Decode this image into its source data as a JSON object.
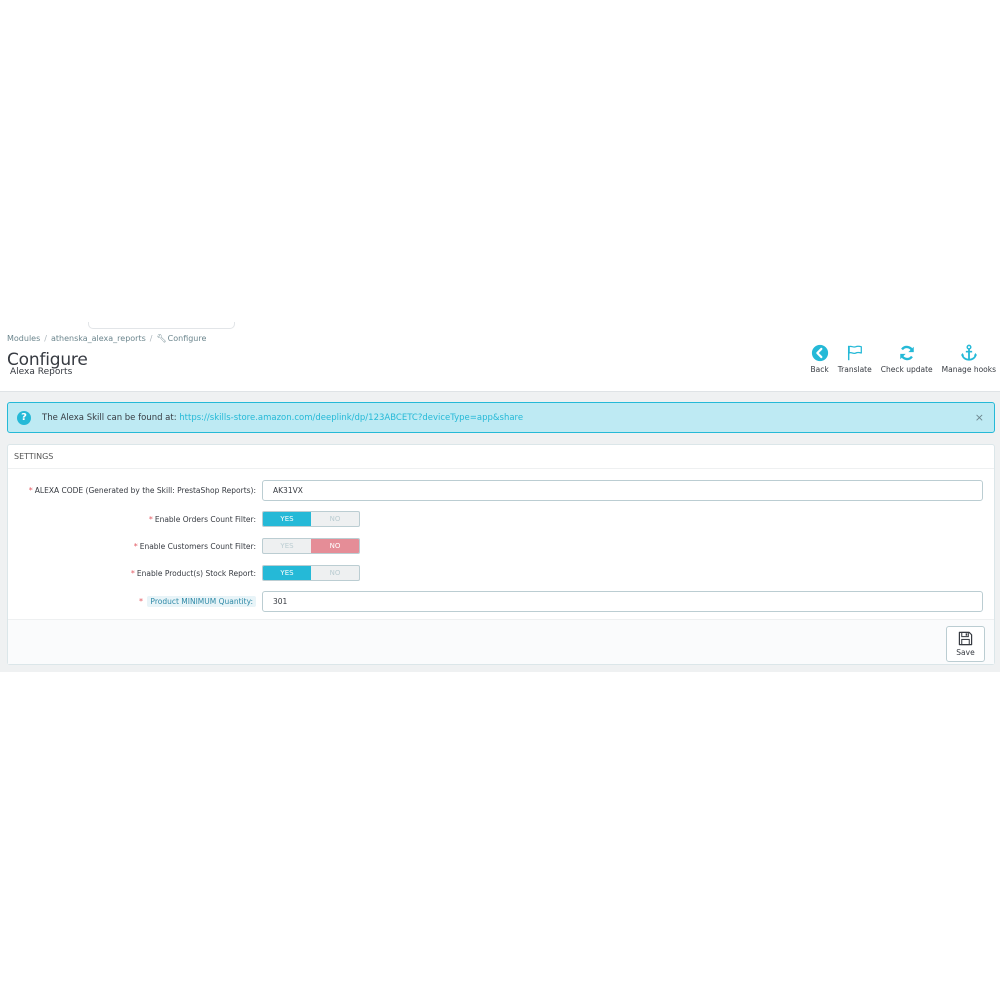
{
  "breadcrumb": {
    "item1": "Modules",
    "item2": "athenska_alexa_reports",
    "item3": "Configure"
  },
  "header": {
    "title": "Configure",
    "subtitle": "Alexa Reports"
  },
  "toolbar": {
    "back": "Back",
    "translate": "Translate",
    "check_update": "Check update",
    "manage_hooks": "Manage hooks"
  },
  "alert": {
    "text": "The Alexa Skill can be found at: ",
    "link": "https://skills-store.amazon.com/deeplink/dp/123ABCETC?deviceType=app&share",
    "close": "×"
  },
  "settings": {
    "heading": "SETTINGS",
    "alexa_code_label": "ALEXA CODE (Generated by the Skill: PrestaShop Reports):",
    "alexa_code_value": "AK31VX",
    "orders_filter_label": "Enable Orders Count Filter:",
    "customers_filter_label": "Enable Customers Count Filter:",
    "stock_report_label": "Enable Product(s) Stock Report:",
    "min_qty_label": "Product MINIMUM Quantity:",
    "min_qty_value": "301",
    "yes": "YES",
    "no": "NO",
    "required_mark": "*",
    "orders_filter_enabled": true,
    "customers_filter_enabled": false,
    "stock_report_enabled": true
  },
  "footer": {
    "save": "Save"
  },
  "colors": {
    "accent": "#25b9d7",
    "alert_bg": "#beeaf3",
    "switch_no_on": "#e58d97",
    "required": "#e35b64"
  }
}
